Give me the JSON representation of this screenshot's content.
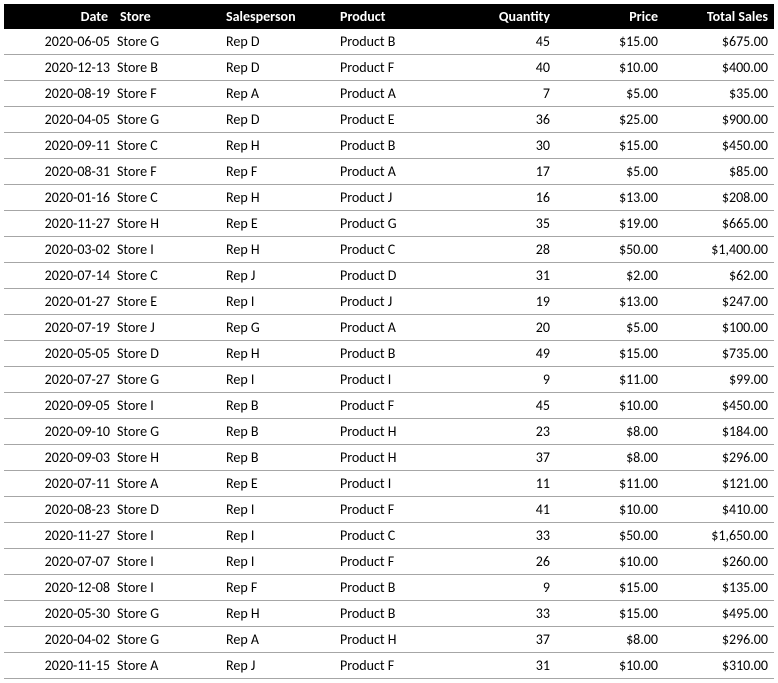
{
  "headers": {
    "date": "Date",
    "store": "Store",
    "rep": "Salesperson",
    "product": "Product",
    "qty": "Quantity",
    "price": "Price",
    "total": "Total Sales"
  },
  "rows": [
    {
      "date": "2020-06-05",
      "store": "Store G",
      "rep": "Rep D",
      "product": "Product B",
      "qty": "45",
      "price": "$15.00",
      "total": "$675.00"
    },
    {
      "date": "2020-12-13",
      "store": "Store B",
      "rep": "Rep D",
      "product": "Product F",
      "qty": "40",
      "price": "$10.00",
      "total": "$400.00"
    },
    {
      "date": "2020-08-19",
      "store": "Store F",
      "rep": "Rep A",
      "product": "Product A",
      "qty": "7",
      "price": "$5.00",
      "total": "$35.00"
    },
    {
      "date": "2020-04-05",
      "store": "Store G",
      "rep": "Rep D",
      "product": "Product E",
      "qty": "36",
      "price": "$25.00",
      "total": "$900.00"
    },
    {
      "date": "2020-09-11",
      "store": "Store C",
      "rep": "Rep H",
      "product": "Product B",
      "qty": "30",
      "price": "$15.00",
      "total": "$450.00"
    },
    {
      "date": "2020-08-31",
      "store": "Store F",
      "rep": "Rep F",
      "product": "Product A",
      "qty": "17",
      "price": "$5.00",
      "total": "$85.00"
    },
    {
      "date": "2020-01-16",
      "store": "Store C",
      "rep": "Rep H",
      "product": "Product J",
      "qty": "16",
      "price": "$13.00",
      "total": "$208.00"
    },
    {
      "date": "2020-11-27",
      "store": "Store H",
      "rep": "Rep E",
      "product": "Product G",
      "qty": "35",
      "price": "$19.00",
      "total": "$665.00"
    },
    {
      "date": "2020-03-02",
      "store": "Store I",
      "rep": "Rep H",
      "product": "Product C",
      "qty": "28",
      "price": "$50.00",
      "total": "$1,400.00"
    },
    {
      "date": "2020-07-14",
      "store": "Store C",
      "rep": "Rep J",
      "product": "Product D",
      "qty": "31",
      "price": "$2.00",
      "total": "$62.00"
    },
    {
      "date": "2020-01-27",
      "store": "Store E",
      "rep": "Rep I",
      "product": "Product J",
      "qty": "19",
      "price": "$13.00",
      "total": "$247.00"
    },
    {
      "date": "2020-07-19",
      "store": "Store J",
      "rep": "Rep G",
      "product": "Product A",
      "qty": "20",
      "price": "$5.00",
      "total": "$100.00"
    },
    {
      "date": "2020-05-05",
      "store": "Store D",
      "rep": "Rep H",
      "product": "Product B",
      "qty": "49",
      "price": "$15.00",
      "total": "$735.00"
    },
    {
      "date": "2020-07-27",
      "store": "Store G",
      "rep": "Rep I",
      "product": "Product I",
      "qty": "9",
      "price": "$11.00",
      "total": "$99.00"
    },
    {
      "date": "2020-09-05",
      "store": "Store I",
      "rep": "Rep B",
      "product": "Product F",
      "qty": "45",
      "price": "$10.00",
      "total": "$450.00"
    },
    {
      "date": "2020-09-10",
      "store": "Store G",
      "rep": "Rep B",
      "product": "Product H",
      "qty": "23",
      "price": "$8.00",
      "total": "$184.00"
    },
    {
      "date": "2020-09-03",
      "store": "Store H",
      "rep": "Rep B",
      "product": "Product H",
      "qty": "37",
      "price": "$8.00",
      "total": "$296.00"
    },
    {
      "date": "2020-07-11",
      "store": "Store A",
      "rep": "Rep E",
      "product": "Product I",
      "qty": "11",
      "price": "$11.00",
      "total": "$121.00"
    },
    {
      "date": "2020-08-23",
      "store": "Store D",
      "rep": "Rep I",
      "product": "Product F",
      "qty": "41",
      "price": "$10.00",
      "total": "$410.00"
    },
    {
      "date": "2020-11-27",
      "store": "Store I",
      "rep": "Rep I",
      "product": "Product C",
      "qty": "33",
      "price": "$50.00",
      "total": "$1,650.00"
    },
    {
      "date": "2020-07-07",
      "store": "Store I",
      "rep": "Rep I",
      "product": "Product F",
      "qty": "26",
      "price": "$10.00",
      "total": "$260.00"
    },
    {
      "date": "2020-12-08",
      "store": "Store I",
      "rep": "Rep F",
      "product": "Product B",
      "qty": "9",
      "price": "$15.00",
      "total": "$135.00"
    },
    {
      "date": "2020-05-30",
      "store": "Store G",
      "rep": "Rep H",
      "product": "Product B",
      "qty": "33",
      "price": "$15.00",
      "total": "$495.00"
    },
    {
      "date": "2020-04-02",
      "store": "Store G",
      "rep": "Rep A",
      "product": "Product H",
      "qty": "37",
      "price": "$8.00",
      "total": "$296.00"
    },
    {
      "date": "2020-11-15",
      "store": "Store A",
      "rep": "Rep J",
      "product": "Product F",
      "qty": "31",
      "price": "$10.00",
      "total": "$310.00"
    }
  ]
}
